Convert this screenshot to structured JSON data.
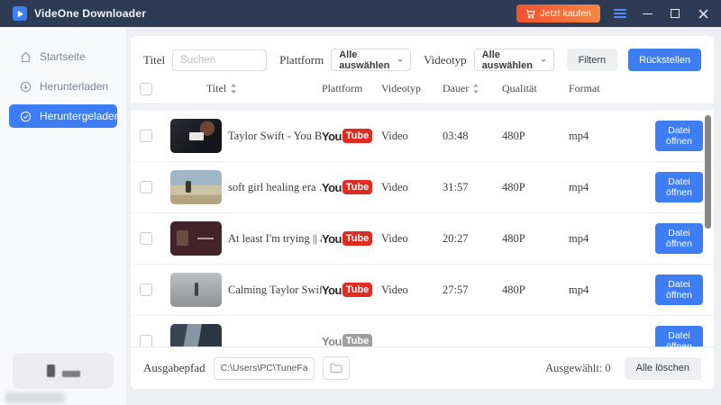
{
  "titlebar": {
    "app_name": "VideOne Downloader",
    "buy_button": "Jetzt kaufen"
  },
  "sidebar": {
    "items": [
      {
        "label": "Startseite",
        "icon": "home-icon",
        "active": false
      },
      {
        "label": "Herunterladen",
        "icon": "download-icon",
        "active": false
      },
      {
        "label": "Heruntergeladen",
        "icon": "check-circle-icon",
        "active": true
      }
    ]
  },
  "filters": {
    "title_label": "Titel",
    "search_placeholder": "Suchen",
    "platform_label": "Plattform",
    "platform_value": "Alle auswählen",
    "videotype_label": "Videotyp",
    "videotype_value": "Alle auswählen",
    "filter_button": "Filtern",
    "reset_button": "Rückstellen"
  },
  "table": {
    "headers": {
      "title": "Titel",
      "platform": "Plattform",
      "videotype": "Videotyp",
      "duration": "Dauer",
      "quality": "Qualität",
      "format": "Format"
    },
    "logo": {
      "you": "You",
      "tube": "Tube"
    },
    "open_button": "Datei öffnen",
    "rows": [
      {
        "title": "Taylor Swift - You Be…",
        "platform": "YouTube",
        "videotype": "Video",
        "duration": "03:48",
        "quality": "480P",
        "format": "mp4"
      },
      {
        "title": "soft girl healing era …",
        "platform": "YouTube",
        "videotype": "Video",
        "duration": "31:57",
        "quality": "480P",
        "format": "mp4"
      },
      {
        "title": "At least I'm trying || a…",
        "platform": "YouTube",
        "videotype": "Video",
        "duration": "20:27",
        "quality": "480P",
        "format": "mp4"
      },
      {
        "title": "Calming Taylor Swift…",
        "platform": "YouTube",
        "videotype": "Video",
        "duration": "27:57",
        "quality": "480P",
        "format": "mp4"
      },
      {
        "title": "",
        "platform": "YouTube",
        "videotype": "",
        "duration": "",
        "quality": "",
        "format": ""
      }
    ]
  },
  "footer": {
    "output_label": "Ausgabepfad",
    "output_path": "C:\\Users\\PC\\TuneFab Vide",
    "selected_label": "Ausgewählt:",
    "selected_count": "0",
    "clear_button": "Alle löschen"
  },
  "colors": {
    "accent_blue": "#3d7ef7",
    "titlebar_bg": "#2d3b55",
    "buy_gradient": [
      "#f4512c",
      "#fa8743"
    ],
    "youtube_red": "#e02b20",
    "sidebar_bg": "#f8f9fb"
  }
}
